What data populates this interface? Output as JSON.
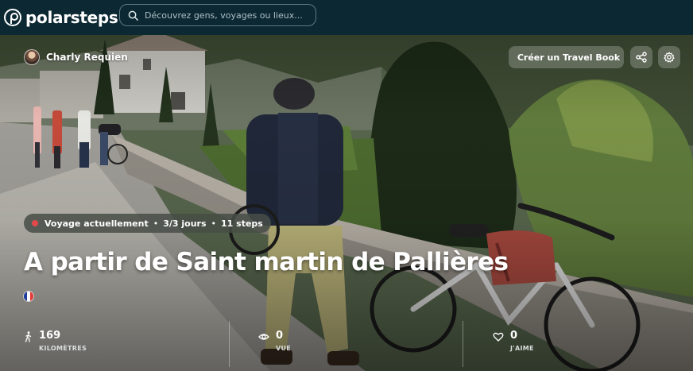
{
  "brand": {
    "name": "polarsteps"
  },
  "search": {
    "placeholder": "Découvrez gens, voyages ou lieux..."
  },
  "author": {
    "name": "Charly Requien"
  },
  "actions": {
    "travel_book_label": "Créer un Travel Book",
    "share_icon": "share-icon",
    "settings_icon": "gear-icon"
  },
  "trip": {
    "status": "Voyage actuellement",
    "days": "3/3 jours",
    "steps": "11 steps",
    "title": "A partir de Saint martin de Pallières",
    "flag": "France"
  },
  "stats": [
    {
      "value": "169",
      "label": "KILOMÈTRES",
      "icon": "walking-icon"
    },
    {
      "value": "0",
      "label": "VUE",
      "icon": "eye-icon"
    },
    {
      "value": "0",
      "label": "J'AIME",
      "icon": "heart-icon"
    }
  ],
  "colors": {
    "topbar": "#0c2933",
    "live_dot": "#e24a4a"
  }
}
